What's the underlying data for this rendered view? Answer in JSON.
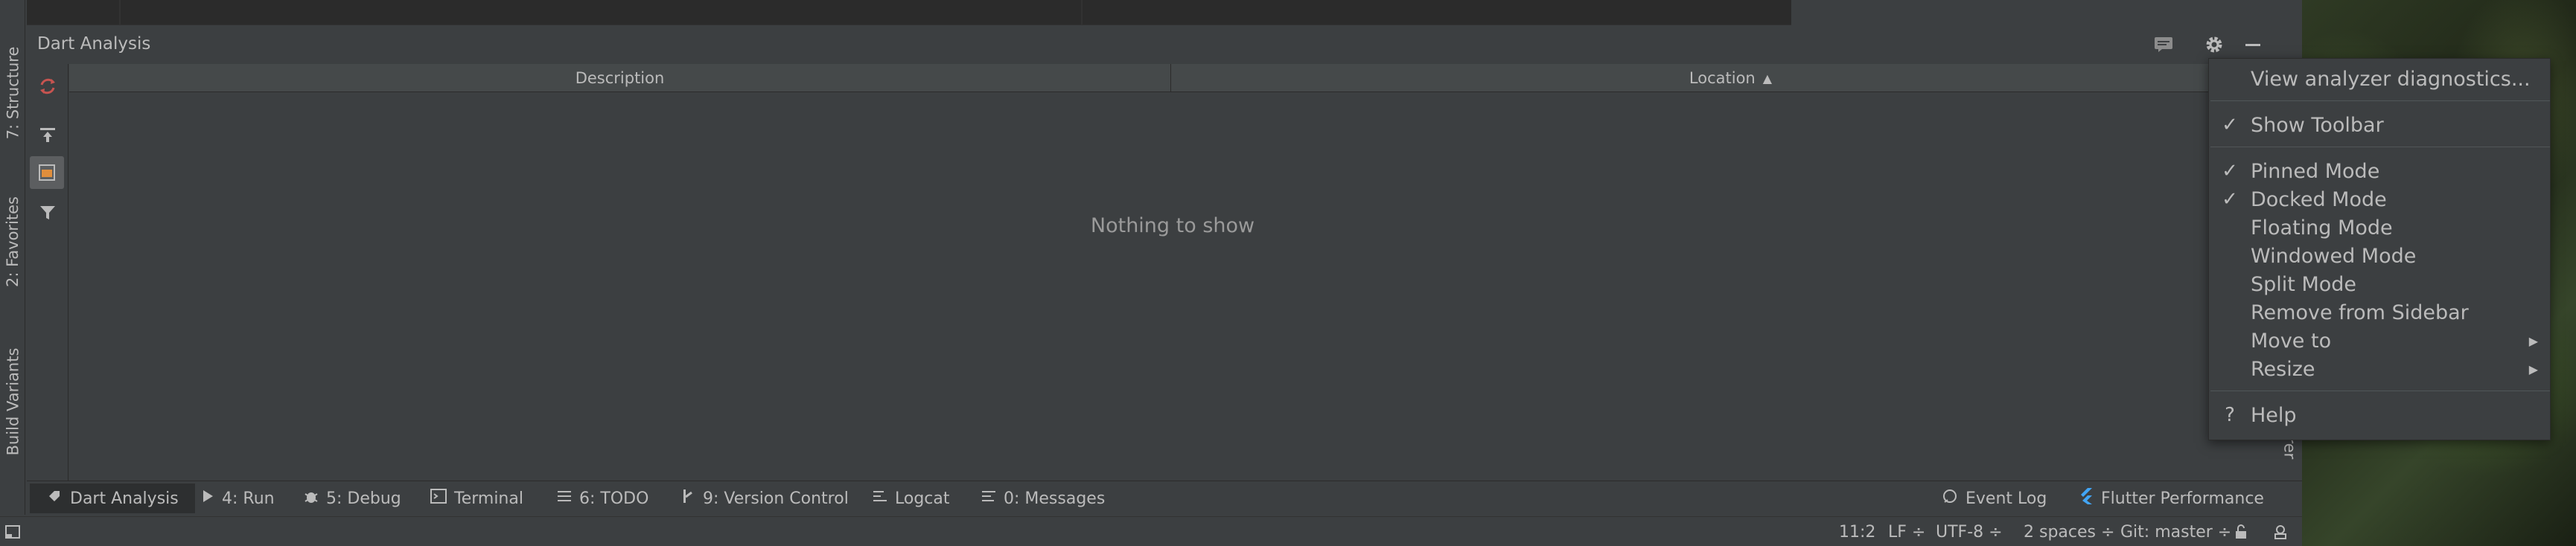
{
  "window": {
    "panel_title": "Dart Analysis"
  },
  "left_tabs": [
    {
      "label": "7: Structure",
      "icon": "structure-icon"
    },
    {
      "label": "2: Favorites",
      "icon": "star-icon"
    },
    {
      "label": "Build Variants",
      "icon": "android-icon"
    }
  ],
  "toolbar": {
    "refresh_icon": "refresh-icon",
    "export_icon": "export-icon",
    "scope_icon": "scope-icon",
    "filter_icon": "filter-icon"
  },
  "table": {
    "columns": [
      "Description",
      "Location"
    ],
    "sort_indicator": "▲",
    "empty_text": "Nothing to show"
  },
  "header_actions": {
    "comment_icon": "comment-icon",
    "settings_icon": "gear-icon",
    "minimize_icon": "minimize-icon"
  },
  "context_menu": {
    "items": [
      {
        "label": "View analyzer diagnostics...",
        "checked": false
      },
      {
        "label": "Show Toolbar",
        "checked": true
      },
      {
        "label": "Pinned Mode",
        "checked": true
      },
      {
        "label": "Docked Mode",
        "checked": true
      },
      {
        "label": "Floating Mode",
        "checked": false
      },
      {
        "label": "Windowed Mode",
        "checked": false
      },
      {
        "label": "Split Mode",
        "checked": false
      },
      {
        "label": "Remove from Sidebar",
        "checked": false
      },
      {
        "label": "Move to",
        "checked": false,
        "submenu": true
      },
      {
        "label": "Resize",
        "checked": false,
        "submenu": true
      },
      {
        "label": "Help",
        "checked": false
      }
    ],
    "check_glyph": "✓",
    "help_glyph": "?",
    "submenu_glyph": "▶"
  },
  "bottom_tabs": [
    {
      "label": "Dart Analysis",
      "active": true
    },
    {
      "label": "4: Run"
    },
    {
      "label": "5: Debug"
    },
    {
      "label": "Terminal"
    },
    {
      "label": "6: TODO"
    },
    {
      "label": "9: Version Control"
    },
    {
      "label": "Logcat"
    },
    {
      "label": "0: Messages"
    }
  ],
  "bottom_right_tabs": [
    {
      "label": "Event Log"
    },
    {
      "label": "Flutter Performance"
    }
  ],
  "right_strip_text": "orer",
  "status": {
    "position": "11:2",
    "line_sep": "LF ÷",
    "encoding": "UTF-8 ÷",
    "indent": "2 spaces ÷",
    "git": "Git: master ÷"
  },
  "colors": {
    "panel_bg": "#3c3f41",
    "editor_bg": "#2b2b2b",
    "text": "#bbbbbb",
    "refresh_red": "#c75450",
    "flutter_blue": "#42a5f5"
  }
}
